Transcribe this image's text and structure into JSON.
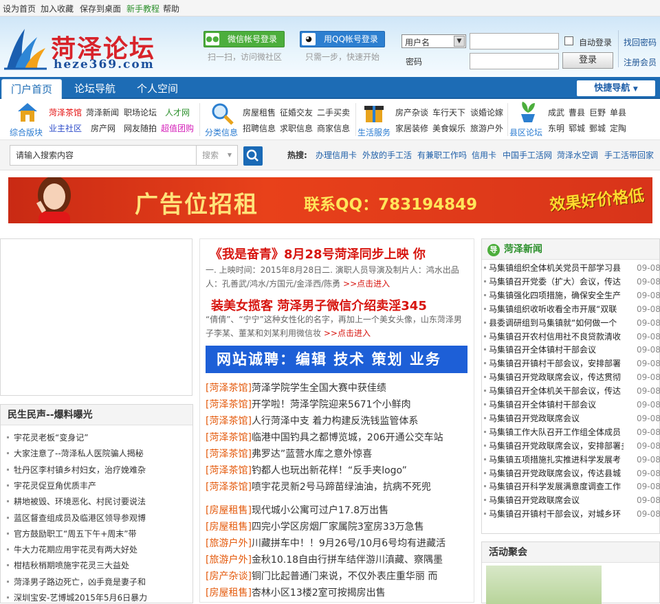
{
  "topbar": {
    "set_home": "设为首页",
    "add_fav": "加入收藏",
    "save_desktop": "保存到桌面",
    "newbie": "新手教程",
    "help": "帮助",
    "newbie_color": "#2a8f2a"
  },
  "header": {
    "logo_cn": "菏泽论坛",
    "logo_en": "heze369.com",
    "wechat_btn": "微信帐号登录",
    "wechat_tip": "扫一扫，访问微社区",
    "qq_btn": "用QQ帐号登录",
    "qq_tip": "只需一步，快速开始",
    "login": {
      "type_selected": "用户名",
      "password_label": "密码",
      "auto_login": "自动登录",
      "login_btn": "登录",
      "forgot": "找回密码",
      "register": "注册会员"
    }
  },
  "nav": {
    "tabs": [
      "门户首页",
      "论坛导航",
      "个人空间"
    ],
    "active": 0,
    "quick": "快捷导航"
  },
  "categories": [
    {
      "name": "综合版块",
      "links": [
        [
          "菏泽茶馆",
          "菏泽新闻",
          "职场论坛",
          "人才网"
        ],
        [
          "业主社区",
          "房产网",
          "网友随拍",
          "超值团购"
        ]
      ]
    },
    {
      "name": "分类信息",
      "links": [
        [
          "房屋租售",
          "征婚交友",
          "二手买卖"
        ],
        [
          "招聘信息",
          "求职信息",
          "商家信息"
        ]
      ]
    },
    {
      "name": "生活服务",
      "links": [
        [
          "房产杂谈",
          "车行天下",
          "谈婚论嫁"
        ],
        [
          "家居装修",
          "美食娱乐",
          "旅游户外"
        ]
      ]
    },
    {
      "name": "县区论坛",
      "links": [
        [
          "成武",
          "曹县",
          "巨野",
          "单县"
        ],
        [
          "东明",
          "郓城",
          "鄄城",
          "定陶"
        ]
      ]
    }
  ],
  "search": {
    "placeholder": "请输入搜索内容",
    "select": "搜索",
    "hot_label": "热搜:",
    "hot": [
      "办理信用卡",
      "外放的手工活",
      "有兼职工作吗",
      "信用卡",
      "中国手工活网",
      "菏泽水空调",
      "手工活带回家"
    ]
  },
  "banner": {
    "title": "广告位招租",
    "contact": "联系QQ：783194849",
    "slogan": "效果好价格低"
  },
  "left": {
    "title": "民生民声--爆料曝光",
    "items": [
      "宇花灵老板“变身记”",
      "大家注意了--菏泽私人医院骗人揭秘",
      "牡丹区李村镇乡村妇女，治疗娩难杂",
      "宇花灵促豆角优质丰产",
      "耕地被毁、环境恶化、村民讨要说法",
      "蓝区督查组成员及临港区领导参观博",
      "官方鼓励职工“周五下午+周末”带",
      "牛大力花期应用宇花灵有两大好处",
      "柑桔秋梢期喷施宇花灵三大益处",
      "菏泽男子路边死亡，凶手竟是妻子和",
      "深圳宝安-艺博城2015年5月6日暴力"
    ]
  },
  "center": {
    "hl1": "《我是奋青》8月28号菏泽同步上映  你",
    "sum1": "一. 上映时间：2015年8月28日二. 演职人员导演及制片人：鸿水出品人：孔善武/鸿水/方国元/金泽西/陈勇",
    "more1": ">>点击进入",
    "hl2": "装美女揽客  菏泽男子微信介绍卖淫345",
    "sum2": "“倩倩”、“宁宁”这种女性化的名字，再加上一个美女头像，山东菏泽男子李某、董某和刘某利用微信妆",
    "more2": ">>点击进入",
    "recruit": "网站诚聘：编辑 技术 策划 业务",
    "group1": [
      {
        "tag": "[菏泽茶馆]",
        "title": "菏泽学院学生全国大赛中获佳绩"
      },
      {
        "tag": "[菏泽茶馆]",
        "title": "开学啦！菏泽学院迎来5671个小鲜肉"
      },
      {
        "tag": "[菏泽茶馆]",
        "title": "人行菏泽中支  着力构建反洗钱监管体系"
      },
      {
        "tag": "[菏泽茶馆]",
        "title": "临港中国钓具之都博览城，206开通公交车站"
      },
      {
        "tag": "[菏泽茶馆]",
        "title": "弗罗达”蓝营水库之意外惊喜"
      },
      {
        "tag": "[菏泽茶馆]",
        "title": "钓都人也玩出新花样！“反手夹logo”"
      },
      {
        "tag": "[菏泽茶馆]",
        "title": "喷宇花灵新2号马蹄苗绿油油，抗病不死兜"
      }
    ],
    "group2": [
      {
        "tag": "[房屋租售]",
        "title": "现代城小公寓可过户17.8万出售"
      },
      {
        "tag": "[房屋租售]",
        "title": "四完小学区房烟厂家属院3室房33万急售"
      },
      {
        "tag": "[旅游户外]",
        "title": "川藏拼车中！！9月26号/10月6号均有进藏活"
      },
      {
        "tag": "[旅游户外]",
        "title": "金秋10.18自由行拼车结伴游川滇藏、察隅墨"
      },
      {
        "tag": "[房产杂谈]",
        "title": "铜门比起普通门来说，不仅外表庄重华丽  而"
      },
      {
        "tag": "[房屋租售]",
        "title": "杏林小区13楼2室可按揭房出售"
      }
    ]
  },
  "right": {
    "news_title": "菏泽新闻",
    "news": [
      {
        "title": "马集镇组织全体机关党员干部学习县",
        "date": "09-08"
      },
      {
        "title": "马集镇召开党委（扩大）会议，传达",
        "date": "09-08"
      },
      {
        "title": "马集镇强化四项措施，确保安全生产",
        "date": "09-08"
      },
      {
        "title": "马集镇组织收听收看全市开展“双联",
        "date": "09-08"
      },
      {
        "title": "县委调研组到马集镇就“如何做一个",
        "date": "09-08"
      },
      {
        "title": "马集镇召开农村信用社不良贷款清收",
        "date": "09-08"
      },
      {
        "title": "马集镇召开全体镇村干部会议",
        "date": "09-08"
      },
      {
        "title": "马集镇召开镇村干部会议，安排部署",
        "date": "09-08"
      },
      {
        "title": "马集镇召开党政联席会议，传达贯彻",
        "date": "09-08"
      },
      {
        "title": "马集镇召开全体机关干部会议，传达",
        "date": "09-08"
      },
      {
        "title": "马集镇召开全体镇村干部会议",
        "date": "09-08"
      },
      {
        "title": "马集镇召开党政联席会议",
        "date": "09-08"
      },
      {
        "title": "马集镇工作大队召开工作组全体成员",
        "date": "09-08"
      },
      {
        "title": "马集镇召开党政联席会议，安排部署多",
        "date": "09-08"
      },
      {
        "title": "马集镇五项措施扎实推进科学发展考",
        "date": "09-08"
      },
      {
        "title": "马集镇召开党政联席会议，传达县城",
        "date": "09-08"
      },
      {
        "title": "马集镇召开科学发展满意度调查工作",
        "date": "09-08"
      },
      {
        "title": "马集镇召开党政联席会议",
        "date": "09-08"
      },
      {
        "title": "马集镇召开镇村干部会议，对城乡环",
        "date": "09-08"
      }
    ],
    "activity_title": "活动聚会"
  }
}
